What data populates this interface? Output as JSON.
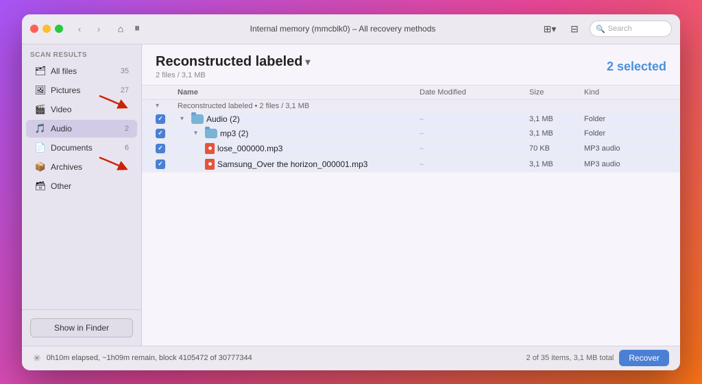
{
  "window": {
    "title": "Internal memory (mmcblk0) – All recovery methods"
  },
  "toolbar": {
    "search_placeholder": "Search",
    "pause_icon": "⏸"
  },
  "sidebar": {
    "section_label": "Scan results",
    "items": [
      {
        "id": "all-files",
        "label": "All files",
        "count": "35",
        "icon": "🗂"
      },
      {
        "id": "pictures",
        "label": "Pictures",
        "count": "27",
        "icon": "🖼"
      },
      {
        "id": "video",
        "label": "Video",
        "count": "",
        "icon": "🎬"
      },
      {
        "id": "audio",
        "label": "Audio",
        "count": "2",
        "icon": "🎵"
      },
      {
        "id": "documents",
        "label": "Documents",
        "count": "6",
        "icon": "📄"
      },
      {
        "id": "archives",
        "label": "Archives",
        "count": "",
        "icon": "📦"
      },
      {
        "id": "other",
        "label": "Other",
        "count": "",
        "icon": "🗃"
      }
    ],
    "show_finder_label": "Show in Finder"
  },
  "content": {
    "folder_title": "Reconstructed labeled",
    "folder_title_chevron": "▾",
    "file_count": "2 files / 3,1 MB",
    "selected_badge": "2 selected",
    "table": {
      "headers": [
        "",
        "Name",
        "Date Modified",
        "Size",
        "Kind"
      ],
      "group_label": "Reconstructed labeled • 2 files / 3,1 MB",
      "rows": [
        {
          "level": 1,
          "checked": true,
          "expanded": true,
          "type": "folder",
          "name": "Audio (2)",
          "date": "–",
          "size": "3,1 MB",
          "kind": "Folder"
        },
        {
          "level": 2,
          "checked": true,
          "expanded": true,
          "type": "folder",
          "name": "mp3 (2)",
          "date": "–",
          "size": "3,1 MB",
          "kind": "Folder"
        },
        {
          "level": 3,
          "checked": true,
          "expanded": false,
          "type": "mp3",
          "name": "lose_000000.mp3",
          "date": "–",
          "size": "70 KB",
          "kind": "MP3 audio"
        },
        {
          "level": 3,
          "checked": true,
          "expanded": false,
          "type": "mp3",
          "name": "Samsung_Over the horizon_000001.mp3",
          "date": "–",
          "size": "3,1 MB",
          "kind": "MP3 audio"
        }
      ]
    }
  },
  "status_bar": {
    "elapsed": "0h10m elapsed, ~1h09m remain, block 4105472 of 30777344",
    "items_info": "2 of 35 items, 3,1 MB total",
    "recover_label": "Recover"
  },
  "colors": {
    "accent": "#4a7fd4",
    "selected_badge": "#4a90d9",
    "red_arrow": "#cc2200"
  }
}
